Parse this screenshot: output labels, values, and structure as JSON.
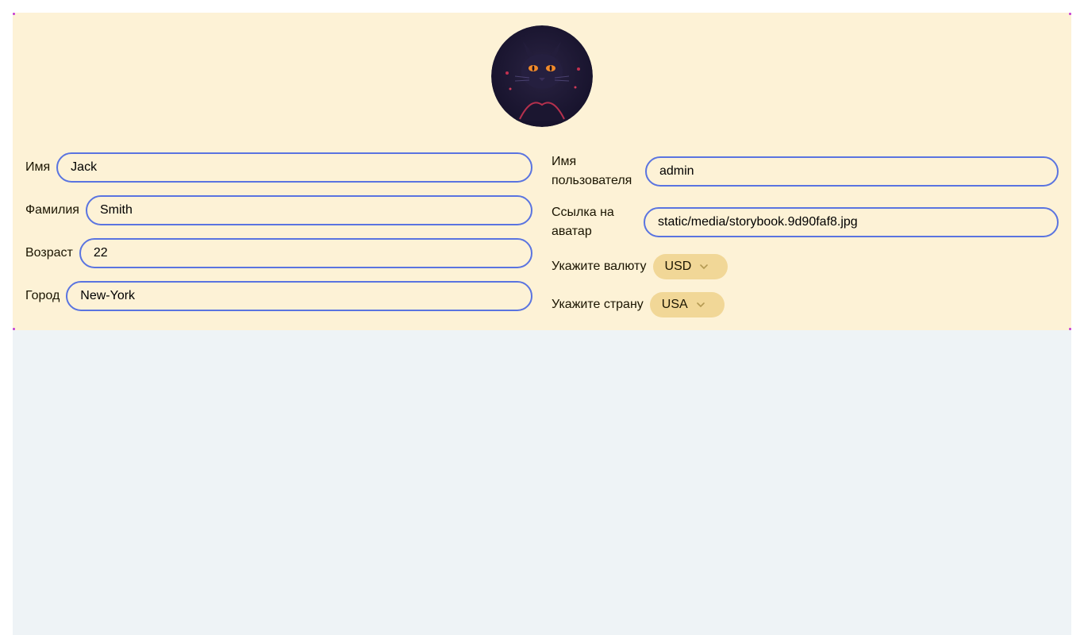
{
  "profile": {
    "left": [
      {
        "label": "Имя",
        "value": "Jack"
      },
      {
        "label": "Фамилия",
        "value": "Smith"
      },
      {
        "label": "Возраст",
        "value": "22"
      },
      {
        "label": "Город",
        "value": "New-York"
      }
    ],
    "right": {
      "username_label": "Имя пользователя",
      "username_value": "admin",
      "avatar_label": "Ссылка на аватар",
      "avatar_value": "static/media/storybook.9d90faf8.jpg",
      "currency_label": "Укажите валюту",
      "currency_value": "USD",
      "country_label": "Укажите страну",
      "country_value": "USA"
    }
  },
  "colors": {
    "card_bg": "#fdf2d6",
    "input_border": "#5a74e0",
    "select_bg": "#f1d797",
    "page_bg": "#eef3f6"
  },
  "icons": {
    "avatar": "black-cat-avatar",
    "select_arrow": "chevron-down-icon"
  }
}
